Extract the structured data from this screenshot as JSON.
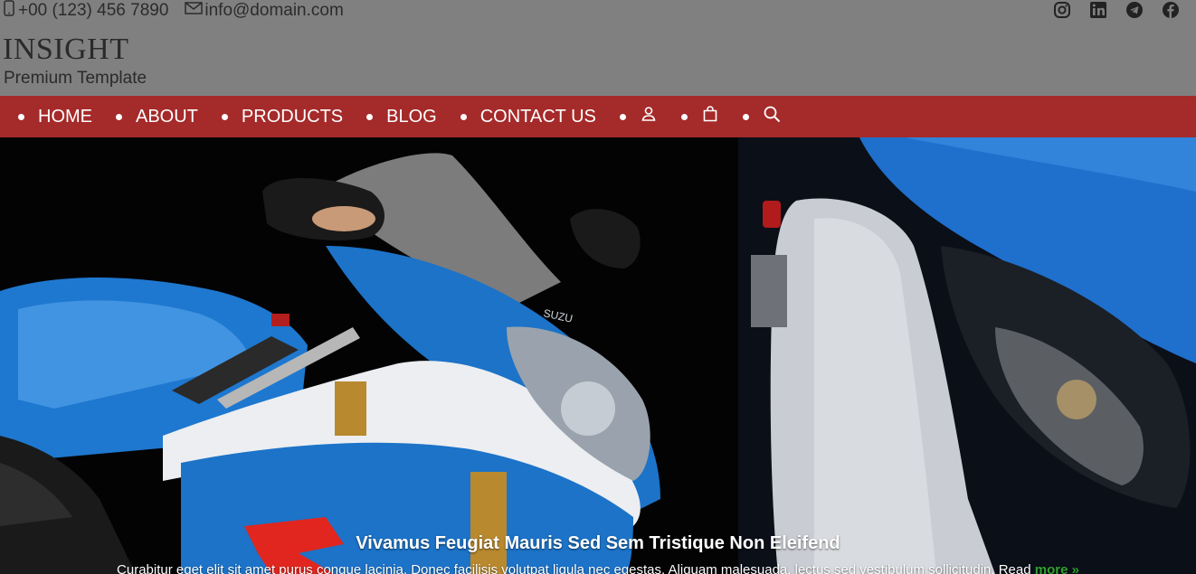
{
  "topbar": {
    "phone": "+00 (123) 456 7890",
    "email": "info@domain.com",
    "socials": [
      "instagram-icon",
      "linkedin-icon",
      "telegram-icon",
      "facebook-icon"
    ]
  },
  "brand": {
    "name": "INSIGHT",
    "tagline": "Premium Template"
  },
  "nav": {
    "items": [
      {
        "label": "HOME"
      },
      {
        "label": "ABOUT"
      },
      {
        "label": "PRODUCTS"
      },
      {
        "label": "BLOG"
      },
      {
        "label": "CONTACT US"
      }
    ],
    "icons": [
      "user-icon",
      "cart-icon",
      "search-icon"
    ]
  },
  "hero": {
    "title": "Vivamus Feugiat Mauris Sed Sem Tristique Non Eleifend",
    "text": "Curabitur eget elit sit amet purus congue lacinia. Donec facilisis volutpat ligula nec egestas. Aliquam malesuada, lectus sed vestibulum sollicitudin. Read",
    "more": "more",
    "more_arrow": "»"
  },
  "colors": {
    "topbar_bg": "#808080",
    "nav_bg": "#a52a2a",
    "accent_more": "#2ea12e",
    "bike_blue": "#1f7fd0"
  }
}
